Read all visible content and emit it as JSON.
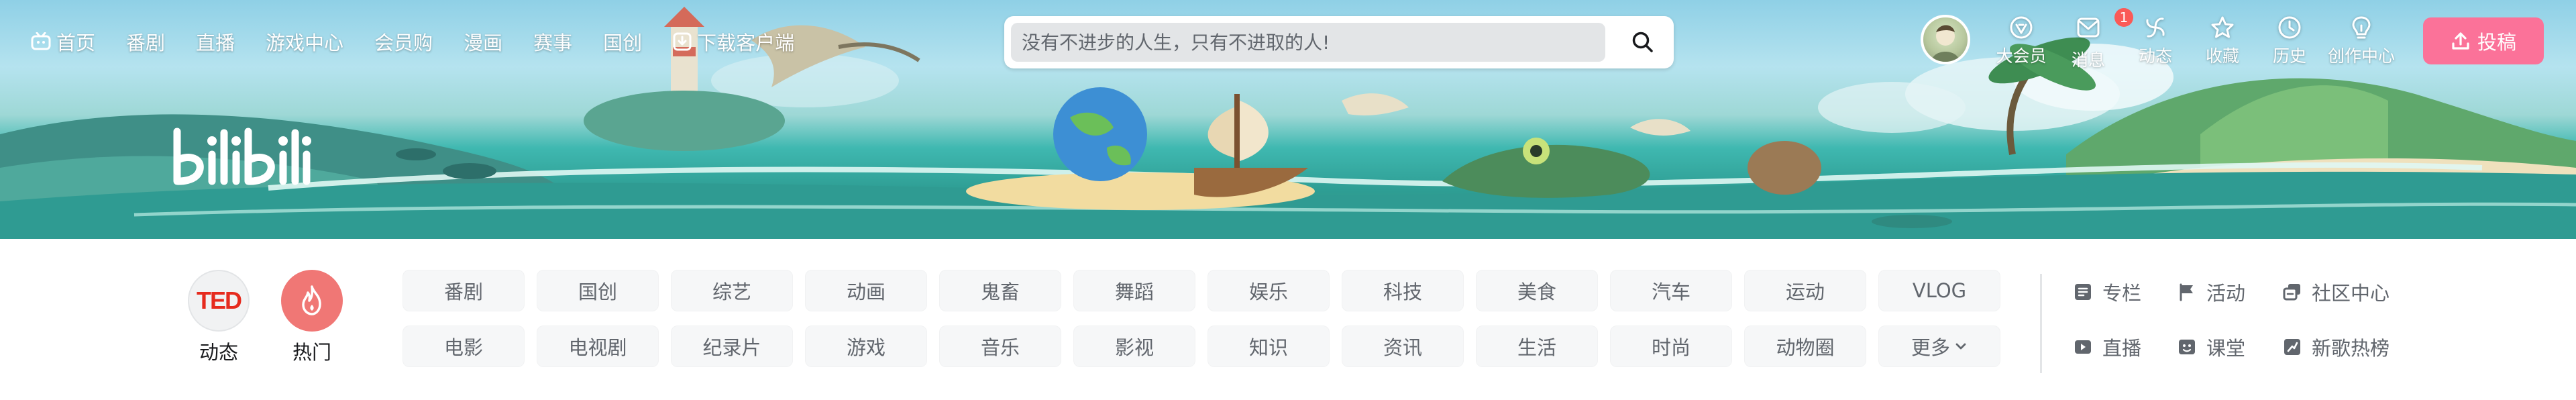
{
  "header": {
    "left_nav": [
      {
        "label": "首页",
        "icon": "tv-icon"
      },
      {
        "label": "番剧"
      },
      {
        "label": "直播"
      },
      {
        "label": "游戏中心"
      },
      {
        "label": "会员购"
      },
      {
        "label": "漫画"
      },
      {
        "label": "赛事"
      },
      {
        "label": "国创"
      },
      {
        "label": "下载客户端",
        "icon": "download-icon"
      }
    ],
    "search": {
      "placeholder": "没有不进步的人生，只有不进取的人!",
      "icon": "search-icon"
    },
    "right_nav": [
      {
        "label": "大会员",
        "icon": "vip-icon"
      },
      {
        "label": "消息",
        "icon": "message-icon",
        "badge": "1"
      },
      {
        "label": "动态",
        "icon": "dynamic-icon"
      },
      {
        "label": "收藏",
        "icon": "star-icon"
      },
      {
        "label": "历史",
        "icon": "clock-icon"
      },
      {
        "label": "创作中心",
        "icon": "lightbulb-icon"
      }
    ],
    "upload_label": "投稿",
    "upload_icon": "upload-icon",
    "logo_text": "bilibili"
  },
  "channels": {
    "quick": [
      {
        "label": "动态",
        "logo_text": "TED"
      },
      {
        "label": "热门",
        "icon": "flame-icon"
      }
    ],
    "grid": [
      "番剧",
      "国创",
      "综艺",
      "动画",
      "鬼畜",
      "舞蹈",
      "娱乐",
      "科技",
      "美食",
      "汽车",
      "运动",
      "VLOG",
      "电影",
      "电视剧",
      "纪录片",
      "游戏",
      "音乐",
      "影视",
      "知识",
      "资讯",
      "生活",
      "时尚",
      "动物圈",
      "更多"
    ],
    "extra": [
      {
        "label": "专栏",
        "icon": "column-icon"
      },
      {
        "label": "活动",
        "icon": "flag-icon"
      },
      {
        "label": "社区中心",
        "icon": "community-icon"
      },
      {
        "label": "直播",
        "icon": "live-icon"
      },
      {
        "label": "课堂",
        "icon": "classroom-icon"
      },
      {
        "label": "新歌热榜",
        "icon": "music-chart-icon"
      }
    ]
  },
  "colors": {
    "accent_pink": "#fb7299",
    "badge_red": "#fa5a57",
    "hot_red": "#f07775",
    "chip_bg": "#f6f7f8",
    "text_gray": "#61666d"
  }
}
